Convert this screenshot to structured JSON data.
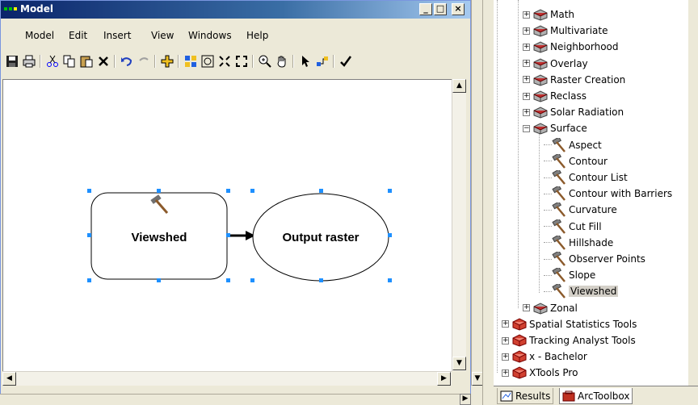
{
  "window": {
    "title": "Model",
    "controls": {
      "minimize": "_",
      "maximize": "□",
      "close": "×"
    }
  },
  "menu": [
    "Model",
    "Edit",
    "Insert",
    "View",
    "Windows",
    "Help"
  ],
  "toolbar": [
    "save-icon",
    "print-icon",
    "cut-icon",
    "copy-icon",
    "paste-icon",
    "delete-icon",
    "undo-icon",
    "redo-icon",
    "add-data-icon",
    "auto-layout-icon",
    "full-extent-icon",
    "zoom-in-fixed-icon",
    "zoom-out-fixed-icon",
    "zoom-in-icon",
    "pan-icon",
    "select-icon",
    "connect-icon",
    "validate-icon"
  ],
  "model": {
    "tool_label": "Viewshed",
    "output_label": "Output raster"
  },
  "tree": {
    "items": [
      {
        "label": "Math",
        "kind": "toolset",
        "expander": "+"
      },
      {
        "label": "Multivariate",
        "kind": "toolset",
        "expander": "+"
      },
      {
        "label": "Neighborhood",
        "kind": "toolset",
        "expander": "+"
      },
      {
        "label": "Overlay",
        "kind": "toolset",
        "expander": "+"
      },
      {
        "label": "Raster Creation",
        "kind": "toolset",
        "expander": "+"
      },
      {
        "label": "Reclass",
        "kind": "toolset",
        "expander": "+"
      },
      {
        "label": "Solar Radiation",
        "kind": "toolset",
        "expander": "+"
      },
      {
        "label": "Surface",
        "kind": "toolset",
        "expander": "−"
      },
      {
        "label": "Aspect",
        "kind": "tool"
      },
      {
        "label": "Contour",
        "kind": "tool"
      },
      {
        "label": "Contour List",
        "kind": "tool"
      },
      {
        "label": "Contour with Barriers",
        "kind": "tool"
      },
      {
        "label": "Curvature",
        "kind": "tool"
      },
      {
        "label": "Cut Fill",
        "kind": "tool"
      },
      {
        "label": "Hillshade",
        "kind": "tool"
      },
      {
        "label": "Observer Points",
        "kind": "tool"
      },
      {
        "label": "Slope",
        "kind": "tool"
      },
      {
        "label": "Viewshed",
        "kind": "tool",
        "selected": true
      },
      {
        "label": "Zonal",
        "kind": "toolset",
        "expander": "+"
      },
      {
        "label": "Spatial Statistics Tools",
        "kind": "toolbox",
        "expander": "+"
      },
      {
        "label": "Tracking Analyst Tools",
        "kind": "toolbox",
        "expander": "+"
      },
      {
        "label": "x - Bachelor",
        "kind": "toolbox",
        "expander": "+"
      },
      {
        "label": "XTools Pro",
        "kind": "toolbox",
        "expander": "+"
      }
    ]
  },
  "tabs": {
    "results": "Results",
    "arctoolbox": "ArcToolbox"
  },
  "colors": {
    "title_bar_start": "#0a246a",
    "title_bar_end": "#a6caf0",
    "selection_handle": "#1e90ff",
    "toolset_red": "#b22222",
    "selected_bg": "#d4d0c8"
  }
}
